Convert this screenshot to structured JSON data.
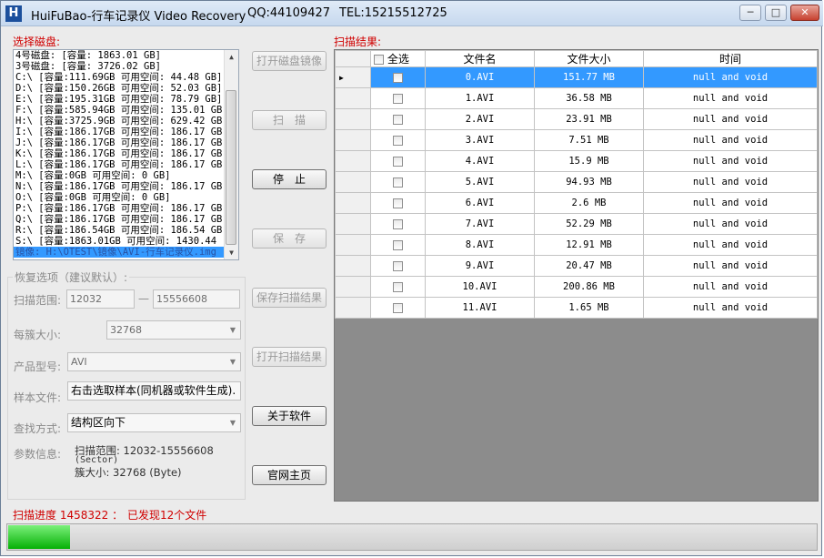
{
  "window": {
    "app_name": "HuiFuBao-行车记录仪 Video Recovery",
    "qq": "QQ:44109427",
    "tel": "TEL:15215512725",
    "minimize": "─",
    "maximize": "□",
    "close": "✕"
  },
  "disk_panel": {
    "label": "选择磁盘:",
    "items": [
      "4号磁盘: [容量: 1863.01 GB]",
      "3号磁盘: [容量: 3726.02 GB]",
      "C:\\ [容量:111.69GB 可用空间: 44.48 GB]",
      "D:\\ [容量:150.26GB 可用空间: 52.03 GB]",
      "E:\\ [容量:195.31GB 可用空间: 78.79 GB]",
      "F:\\ [容量:585.94GB 可用空间: 135.01 GB]",
      "H:\\ [容量:3725.9GB 可用空间: 629.42 GB]",
      "I:\\ [容量:186.17GB 可用空间: 186.17 GB]",
      "J:\\ [容量:186.17GB 可用空间: 186.17 GB]",
      "K:\\ [容量:186.17GB 可用空间: 186.17 GB]",
      "L:\\ [容量:186.17GB 可用空间: 186.17 GB]",
      "M:\\ [容量:0GB 可用空间: 0 GB]",
      "N:\\ [容量:186.17GB 可用空间: 186.17 GB]",
      "O:\\ [容量:0GB 可用空间: 0 GB]",
      "P:\\ [容量:186.17GB 可用空间: 186.17 GB]",
      "Q:\\ [容量:186.17GB 可用空间: 186.17 GB]",
      "R:\\ [容量:186.54GB 可用空间: 186.54 GB]",
      "S:\\ [容量:1863.01GB 可用空间: 1430.44",
      "镜像: H:\\OTEST\\镜像\\AVI-行车记录仪.img"
    ],
    "selected_index": 18
  },
  "buttons": {
    "open_image": "打开磁盘镜像",
    "scan": "扫　描",
    "stop": "停　止",
    "save": "保　存",
    "save_scan": "保存扫描结果",
    "open_scan": "打开扫描结果",
    "about": "关于软件",
    "website": "官网主页"
  },
  "options": {
    "group_title": "恢复选项（建议默认）:",
    "range_label": "扫描范围:",
    "range_start": "12032",
    "range_dash": "—",
    "range_end": "15556608",
    "cluster_label": "每簇大小:",
    "cluster_value": "32768",
    "product_label": "产品型号:",
    "product_value": "AVI",
    "sample_label": "样本文件:",
    "sample_value": "右击选取样本(同机器或软件生成).",
    "find_label": "查找方式:",
    "find_value": "结构区向下",
    "params_label": "参数信息:",
    "params_range": "扫描范围: 12032-15556608",
    "params_unit": "(Sector)",
    "params_cluster": "簇大小: 32768 (Byte)"
  },
  "results": {
    "label": "扫描结果:",
    "headers": {
      "select_all": "全选",
      "name": "文件名",
      "size": "文件大小",
      "time": "时间"
    },
    "rows": [
      {
        "name": "0.AVI",
        "size": "151.77 MB",
        "time": "null and void"
      },
      {
        "name": "1.AVI",
        "size": "36.58 MB",
        "time": "null and void"
      },
      {
        "name": "2.AVI",
        "size": "23.91 MB",
        "time": "null and void"
      },
      {
        "name": "3.AVI",
        "size": "7.51 MB",
        "time": "null and void"
      },
      {
        "name": "4.AVI",
        "size": "15.9 MB",
        "time": "null and void"
      },
      {
        "name": "5.AVI",
        "size": "94.93 MB",
        "time": "null and void"
      },
      {
        "name": "6.AVI",
        "size": "2.6 MB",
        "time": "null and void"
      },
      {
        "name": "7.AVI",
        "size": "52.29 MB",
        "time": "null and void"
      },
      {
        "name": "8.AVI",
        "size": "12.91 MB",
        "time": "null and void"
      },
      {
        "name": "9.AVI",
        "size": "20.47 MB",
        "time": "null and void"
      },
      {
        "name": "10.AVI",
        "size": "200.86 MB",
        "time": "null and void"
      },
      {
        "name": "11.AVI",
        "size": "1.65 MB",
        "time": "null and void"
      }
    ],
    "selected_row": 0
  },
  "status": {
    "progress_label": "扫描进度 1458322 ：",
    "found": "已发现12个文件",
    "progress_fraction": 0.077
  },
  "colors": {
    "label_red": "#d00000",
    "selection_blue": "#3399ff",
    "progress_green": "#06b006"
  }
}
